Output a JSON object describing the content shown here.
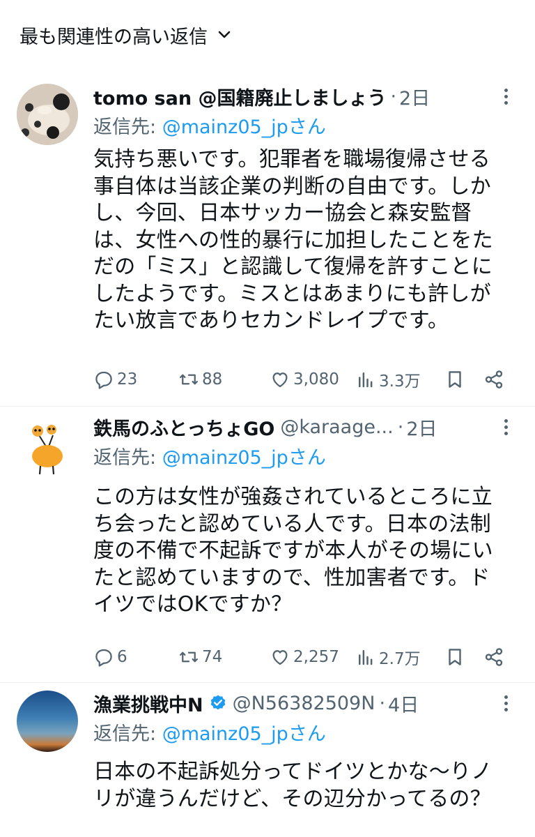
{
  "sort": {
    "label": "最も関連性の高い返信"
  },
  "colors": {
    "link": "#1d9bf0",
    "secondary": "#536471",
    "text": "#0f1419",
    "verified": "#1d9bf0"
  },
  "tweets": [
    {
      "name": "tomo san @国籍廃止しましょう",
      "handle": "",
      "time": "2日",
      "reply_prefix": "返信先: ",
      "reply_user": "@mainz05_jpさん",
      "lines": [
        "気持ち悪いです。犯罪者を職場復帰させる",
        "事自体は当該企業の判断の自由です。しか",
        "し、今回、日本サッカー協会と森安監督",
        "は、女性への性的暴行に加担したことをた",
        "だの「ミス」と認識して復帰を許すことに",
        "したようです。ミスとはあまりにも許しが",
        "たい放言でありセカンドレイプです。"
      ],
      "stats": {
        "replies": "23",
        "retweets": "88",
        "likes": "3,080",
        "views": "3.3万"
      }
    },
    {
      "name": "鉄馬のふとっちょGO",
      "handle": "@karaage...",
      "time": "2日",
      "reply_prefix": "返信先: ",
      "reply_user": "@mainz05_jpさん",
      "lines": [
        "この方は女性が強姦されているところに立",
        "ち会ったと認めている人です。日本の法制",
        "度の不備で不起訴ですが本人がその場にい",
        "たと認めていますので、性加害者です。ド",
        "イツではOKですか？"
      ],
      "stats": {
        "replies": "6",
        "retweets": "74",
        "likes": "2,257",
        "views": "2.7万"
      }
    },
    {
      "name": "漁業挑戦中N",
      "handle": "@N56382509N",
      "time": "4日",
      "reply_prefix": "返信先: ",
      "reply_user": "@mainz05_jpさん",
      "lines": [
        "日本の不起訴処分ってドイツとかな〜りノ",
        "リが違うんだけど、その辺分かってるの？"
      ]
    }
  ]
}
